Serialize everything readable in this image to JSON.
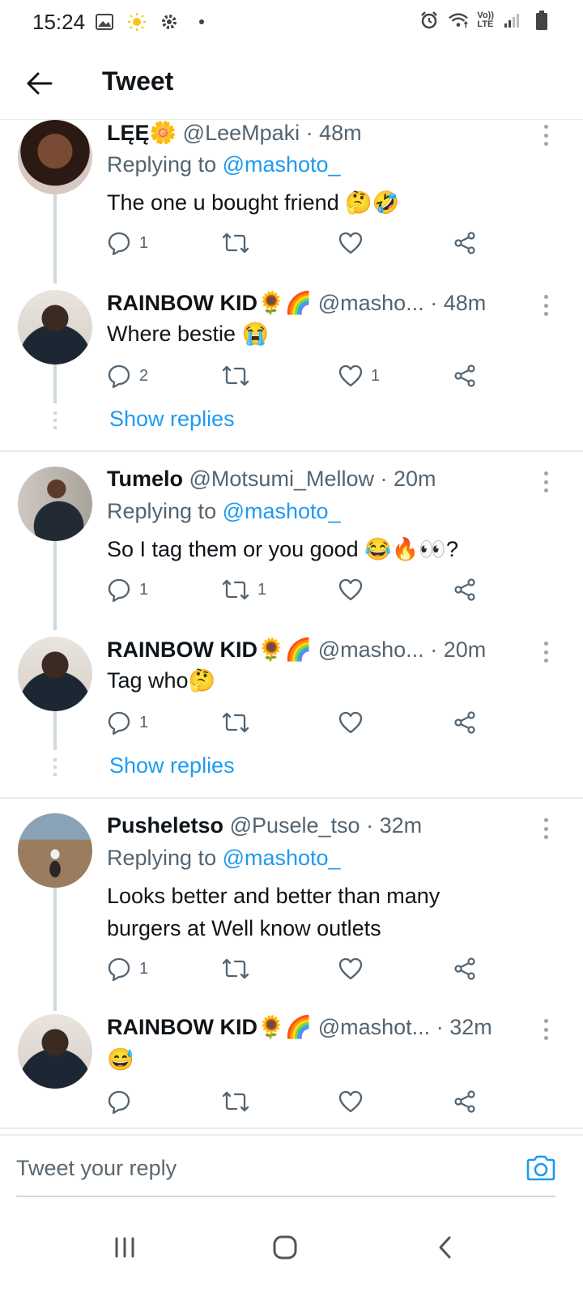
{
  "status_bar": {
    "time": "15:24",
    "icons_left": [
      "gallery-icon",
      "sun-icon",
      "gear-icon",
      "dot-icon"
    ],
    "icons_right": [
      "alarm-icon",
      "wifi-icon",
      "volte-icon",
      "signal-icon",
      "battery-icon"
    ],
    "volte_line1": "Vo))",
    "volte_line2": "LTE"
  },
  "header": {
    "title": "Tweet"
  },
  "colors": {
    "accent": "#1d9bf0",
    "muted": "#536471",
    "divider": "#e6ecf0",
    "text": "#0f1419"
  },
  "tweets": [
    {
      "name": "LĘĘ🌼",
      "handle": "@LeeMpaki",
      "time": "· 48m",
      "replying_prefix": "Replying to ",
      "replying_to": "@mashoto_",
      "text": "The one u bought friend 🤔🤣",
      "reply_count": "1",
      "retweet_count": "",
      "like_count": ""
    },
    {
      "name": "RAINBOW KID🌻🌈",
      "handle": "@masho...",
      "time": "· 48m",
      "text": "Where bestie 😭",
      "reply_count": "2",
      "retweet_count": "",
      "like_count": "1",
      "show_replies": "Show replies"
    },
    {
      "name": "Tumelo",
      "handle": "@Motsumi_Mellow",
      "time": "· 20m",
      "replying_prefix": "Replying to ",
      "replying_to": "@mashoto_",
      "text": "So I tag them or you good 😂🔥👀?",
      "reply_count": "1",
      "retweet_count": "1",
      "like_count": ""
    },
    {
      "name": "RAINBOW KID🌻🌈",
      "handle": "@masho...",
      "time": "· 20m",
      "text": "Tag who🤔",
      "reply_count": "1",
      "retweet_count": "",
      "like_count": "",
      "show_replies": "Show replies"
    },
    {
      "name": "Pusheletso",
      "handle": "@Pusele_tso",
      "time": "· 32m",
      "replying_prefix": "Replying to ",
      "replying_to": "@mashoto_",
      "text": "Looks better and better than many burgers at Well know outlets",
      "reply_count": "1",
      "retweet_count": "",
      "like_count": ""
    },
    {
      "name": "RAINBOW KID🌻🌈",
      "handle": "@mashot...",
      "time": "· 32m",
      "text": "😅",
      "reply_count": "",
      "retweet_count": "",
      "like_count": ""
    }
  ],
  "reply_bar": {
    "placeholder": "Tweet your reply"
  },
  "nav": {
    "buttons": [
      "recents-icon",
      "home-icon",
      "back-icon"
    ]
  }
}
